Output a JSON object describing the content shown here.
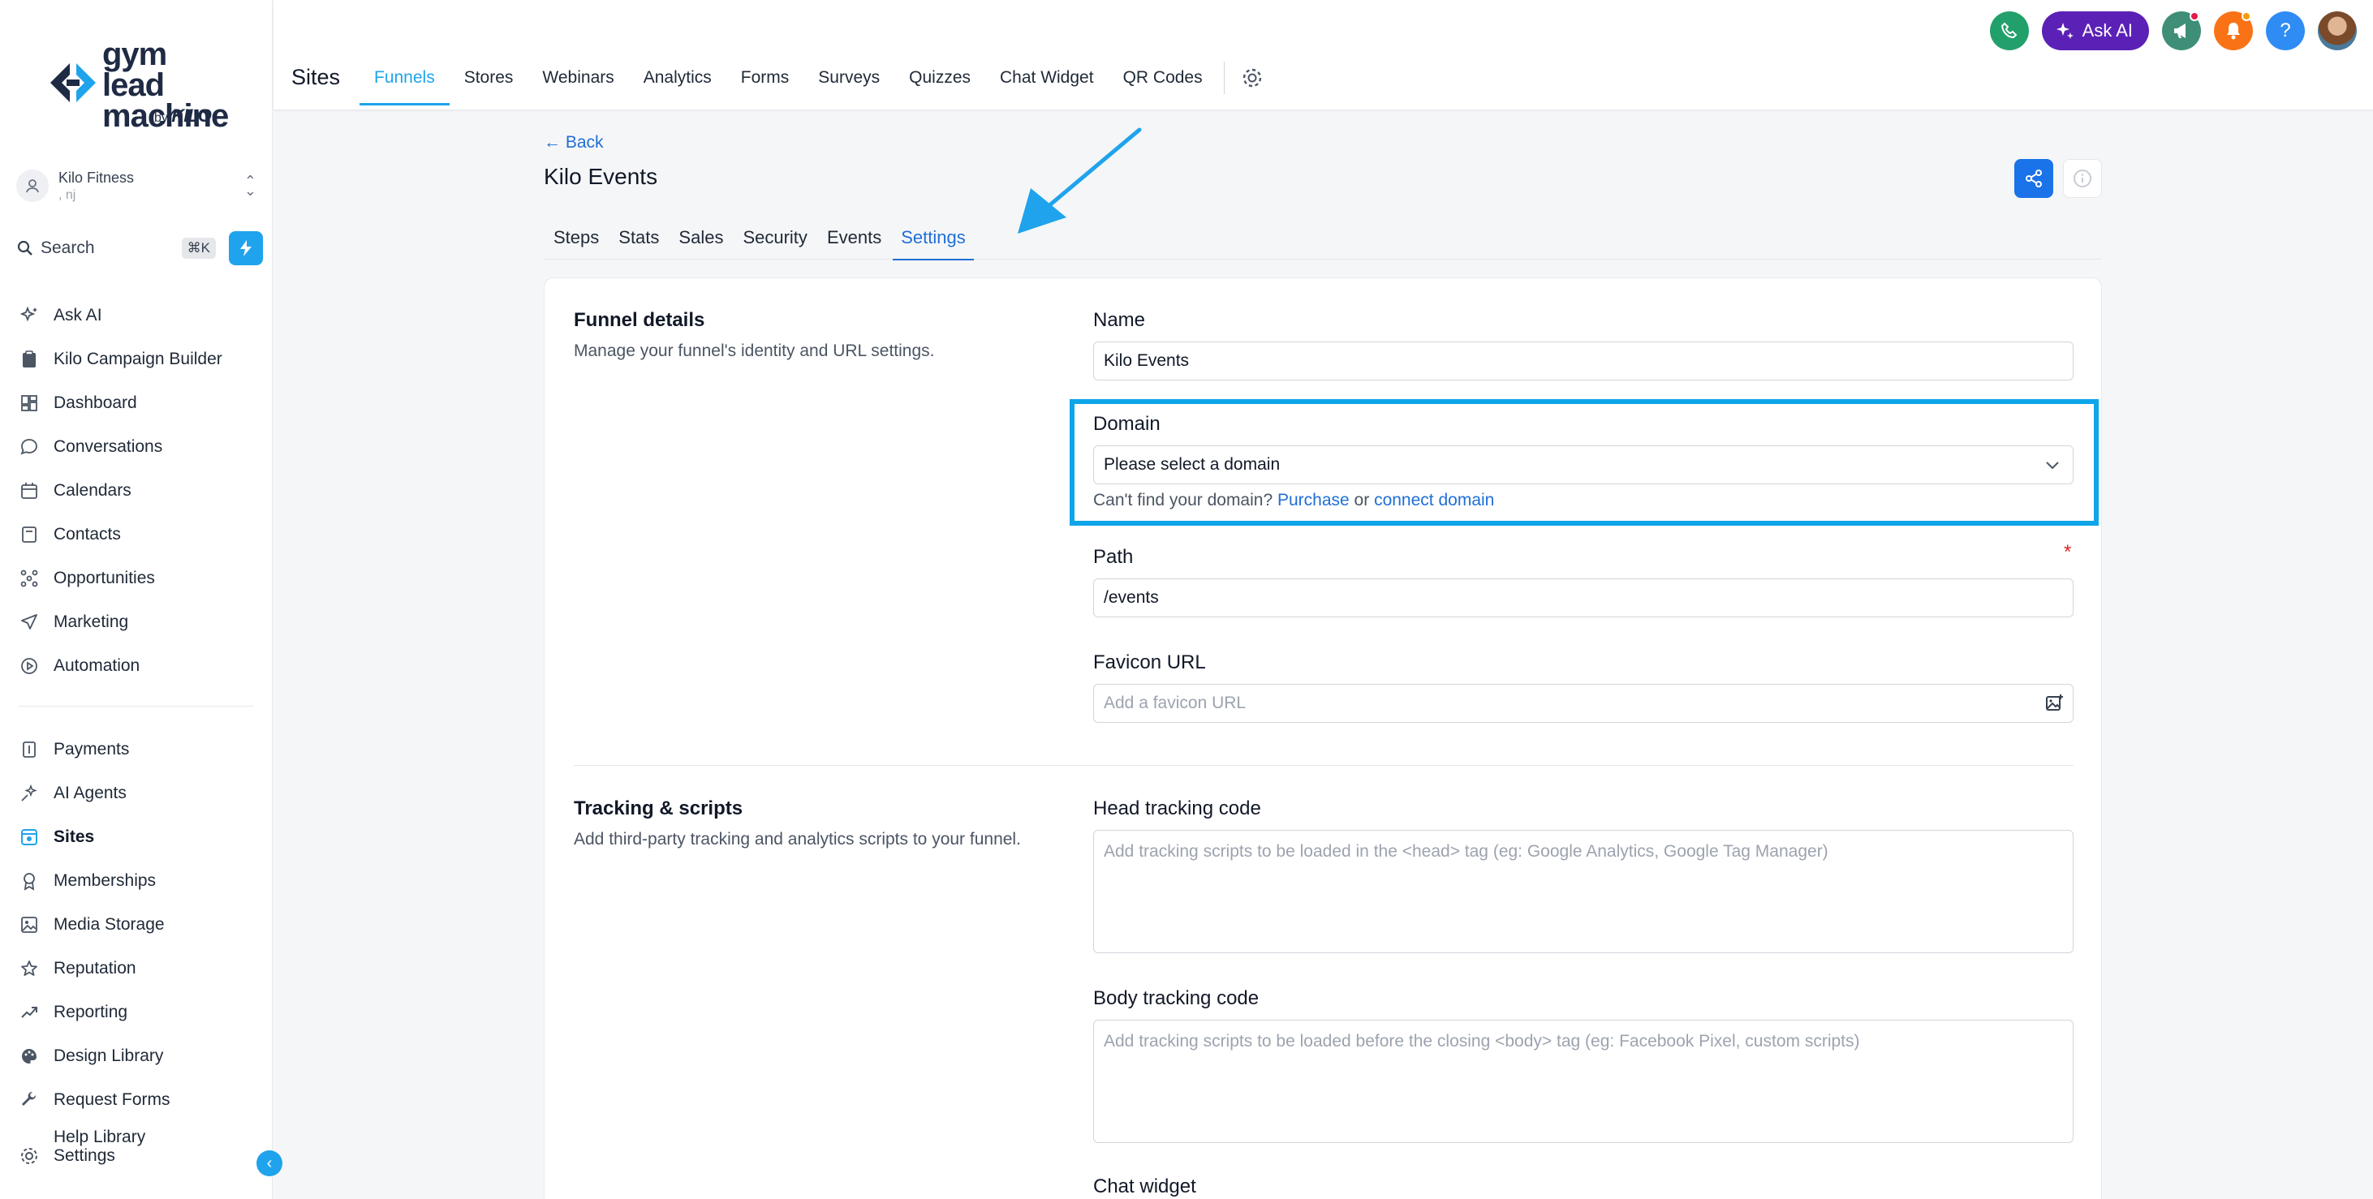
{
  "brand": {
    "logo_line1": "gym lead",
    "logo_line2": "machine",
    "logo_by": "by",
    "logo_kilo": "KILO"
  },
  "account": {
    "name": "Kilo Fitness",
    "location": ", nj"
  },
  "search": {
    "label": "Search",
    "shortcut": "⌘K"
  },
  "sidebar": {
    "items": [
      {
        "label": "Ask AI",
        "icon": "sparkle-icon"
      },
      {
        "label": "Kilo Campaign Builder",
        "icon": "clipboard-icon"
      },
      {
        "label": "Dashboard",
        "icon": "dashboard-icon"
      },
      {
        "label": "Conversations",
        "icon": "chat-bubble-icon"
      },
      {
        "label": "Calendars",
        "icon": "calendar-icon"
      },
      {
        "label": "Contacts",
        "icon": "contacts-icon"
      },
      {
        "label": "Opportunities",
        "icon": "opportunities-icon"
      },
      {
        "label": "Marketing",
        "icon": "send-icon"
      },
      {
        "label": "Automation",
        "icon": "automation-icon"
      }
    ],
    "items2": [
      {
        "label": "Payments",
        "icon": "payments-icon"
      },
      {
        "label": "AI Agents",
        "icon": "ai-agents-icon"
      },
      {
        "label": "Sites",
        "icon": "sites-icon",
        "active": true
      },
      {
        "label": "Memberships",
        "icon": "memberships-icon"
      },
      {
        "label": "Media Storage",
        "icon": "image-icon"
      },
      {
        "label": "Reputation",
        "icon": "star-icon"
      },
      {
        "label": "Reporting",
        "icon": "trend-icon"
      },
      {
        "label": "Design Library",
        "icon": "palette-icon"
      },
      {
        "label": "Request Forms",
        "icon": "wrench-icon"
      }
    ],
    "help": "Help Library",
    "settings": "Settings"
  },
  "topbar": {
    "title": "Sites",
    "tabs": [
      "Funnels",
      "Stores",
      "Webinars",
      "Analytics",
      "Forms",
      "Surveys",
      "Quizzes",
      "Chat Widget",
      "QR Codes"
    ],
    "active_tab": "Funnels",
    "ask_ai": "Ask AI",
    "help_glyph": "?"
  },
  "page": {
    "back": "← Back",
    "title": "Kilo Events",
    "tabs": [
      "Steps",
      "Stats",
      "Sales",
      "Security",
      "Events",
      "Settings"
    ],
    "active_tab": "Settings"
  },
  "funnel_details": {
    "title": "Funnel details",
    "desc": "Manage your funnel's identity and URL settings.",
    "name_label": "Name",
    "name_value": "Kilo Events",
    "domain_label": "Domain",
    "domain_placeholder": "Please select a domain",
    "domain_hint_prefix": "Can't find your domain?",
    "domain_hint_purchase": "Purchase",
    "domain_hint_or": "or",
    "domain_hint_connect": "connect domain",
    "path_label": "Path",
    "path_required": "*",
    "path_value": "/events",
    "favicon_label": "Favicon URL",
    "favicon_placeholder": "Add a favicon URL"
  },
  "tracking": {
    "title": "Tracking & scripts",
    "desc": "Add third-party tracking and analytics scripts to your funnel.",
    "head_label": "Head tracking code",
    "head_placeholder": "Add tracking scripts to be loaded in the <head> tag (eg: Google Analytics, Google Tag Manager)",
    "body_label": "Body tracking code",
    "body_placeholder": "Add tracking scripts to be loaded before the closing <body> tag (eg: Facebook Pixel, custom scripts)",
    "chat_label": "Chat widget"
  },
  "colors": {
    "accent": "#1fa3ec",
    "link": "#1f6fd6",
    "highlight": "#0ea5e9",
    "ask_ai": "#5b21b6"
  }
}
